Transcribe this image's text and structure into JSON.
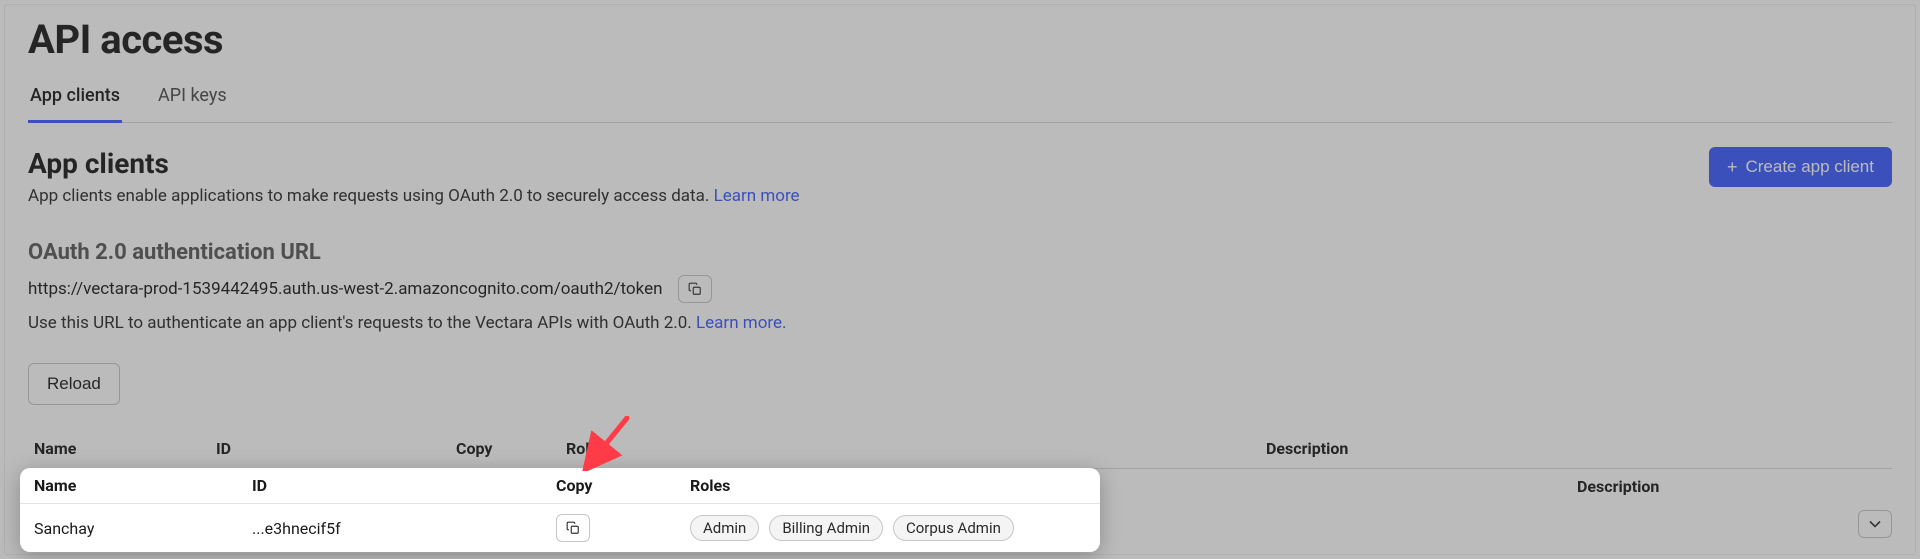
{
  "page": {
    "title": "API access"
  },
  "tabs": [
    {
      "label": "App clients",
      "active": true
    },
    {
      "label": "API keys",
      "active": false
    }
  ],
  "section": {
    "title": "App clients",
    "desc_prefix": "App clients enable applications to make requests using OAuth 2.0 to securely access data. ",
    "learn_more": "Learn more",
    "create_btn": "Create app client"
  },
  "oauth": {
    "heading": "OAuth 2.0 authentication URL",
    "url": "https://vectara-prod-1539442495.auth.us-west-2.amazoncognito.com/oauth2/token",
    "helper_prefix": "Use this URL to authenticate an app client's requests to the Vectara APIs with OAuth 2.0. ",
    "learn_more": "Learn more."
  },
  "buttons": {
    "reload": "Reload"
  },
  "table": {
    "headers": {
      "name": "Name",
      "id": "ID",
      "copy": "Copy",
      "roles": "Roles",
      "description": "Description"
    },
    "row": {
      "name": "Sanchay",
      "id": "...e3hnecif5f",
      "roles": [
        "Admin",
        "Billing Admin",
        "Corpus Admin"
      ],
      "description": ""
    }
  },
  "colors": {
    "accent": "#3b5bff",
    "arrow": "#ff3b47"
  }
}
